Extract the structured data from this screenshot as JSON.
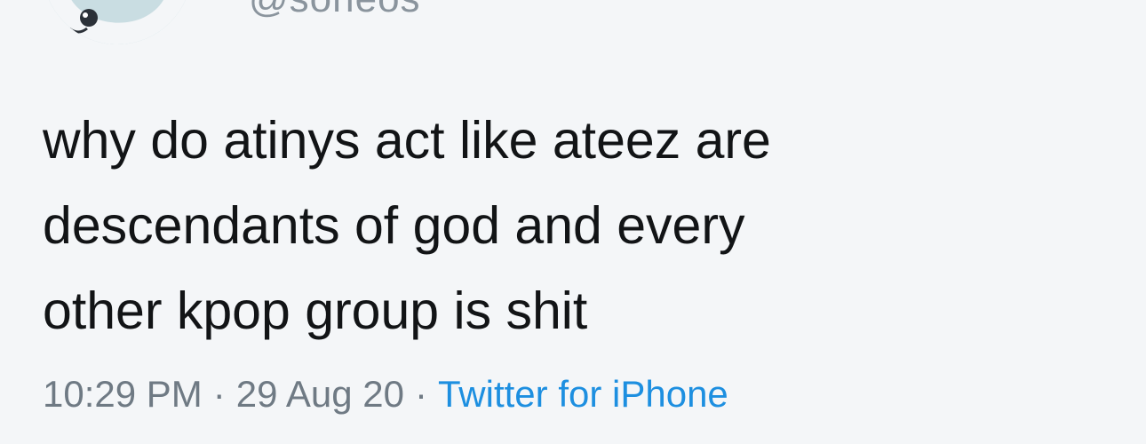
{
  "tweet": {
    "handle": "@soneos",
    "text_lines": [
      "why do atinys act like ateez are",
      "descendants of god and every",
      "other kpop group is shit"
    ],
    "time": "10:29 PM",
    "date": "29 Aug 20",
    "separator": "·",
    "source": "Twitter for iPhone"
  },
  "colors": {
    "background": "#f4f6f8",
    "text": "#121416",
    "meta": "#6f7a84",
    "link": "#1d8fe0",
    "avatar": "#c9dde2"
  },
  "icons": {
    "avatar": "profile-avatar"
  }
}
